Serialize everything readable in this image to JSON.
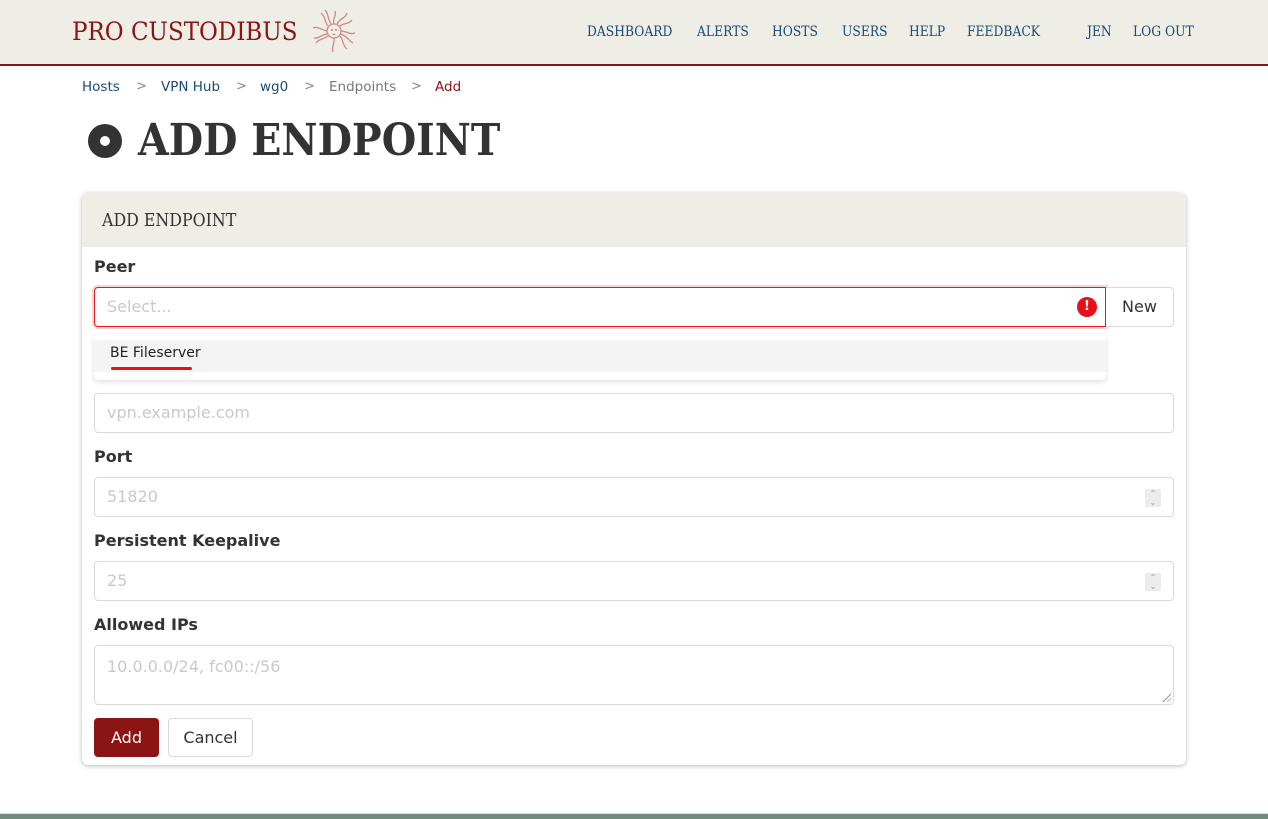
{
  "header": {
    "brand": "PRO CUSTODIBUS",
    "logo_icon": "medusa-logo-icon",
    "nav": [
      {
        "label": "DASHBOARD"
      },
      {
        "label": "ALERTS"
      },
      {
        "label": "HOSTS"
      },
      {
        "label": "USERS"
      },
      {
        "label": "HELP"
      },
      {
        "label": "FEEDBACK"
      }
    ],
    "user": "JEN",
    "logout": "LOG OUT"
  },
  "breadcrumb": [
    {
      "label": "Hosts",
      "state": "link"
    },
    {
      "label": "VPN Hub",
      "state": "link"
    },
    {
      "label": "wg0",
      "state": "link"
    },
    {
      "label": "Endpoints",
      "state": "muted"
    },
    {
      "label": "Add",
      "state": "active"
    }
  ],
  "breadcrumb_separator": ">",
  "page": {
    "title": "ADD ENDPOINT",
    "title_icon": "endpoint-circle-icon"
  },
  "form": {
    "card_title": "ADD ENDPOINT",
    "peer": {
      "label": "Peer",
      "placeholder": "Select...",
      "error_icon": "!",
      "new_button": "New",
      "dropdown_options": [
        "BE Fileserver"
      ]
    },
    "hostname": {
      "placeholder": "vpn.example.com"
    },
    "port": {
      "label": "Port",
      "placeholder": "51820"
    },
    "keepalive": {
      "label": "Persistent Keepalive",
      "placeholder": "25"
    },
    "allowed_ips": {
      "label": "Allowed IPs",
      "placeholder": "10.0.0.0/24, fc00::/56"
    },
    "submit": "Add",
    "cancel": "Cancel"
  },
  "colors": {
    "brand": "#8b1414",
    "nav_link": "#1a4a7a",
    "header_bg": "#eeede6",
    "error": "#e8101a",
    "footer": "#738a80"
  }
}
